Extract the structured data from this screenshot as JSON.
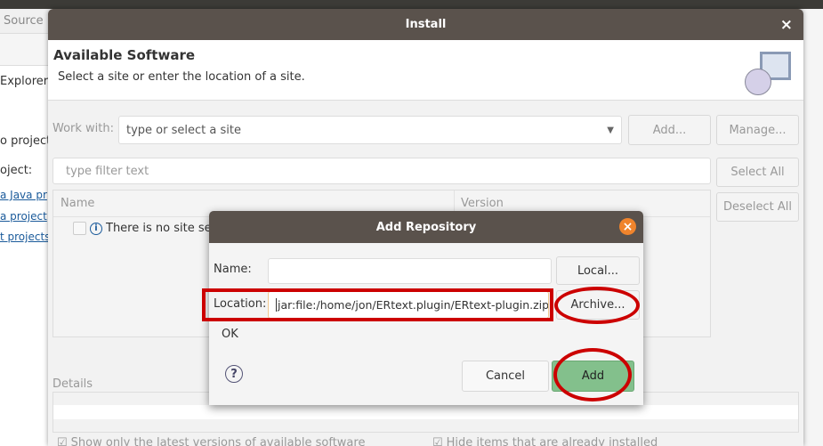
{
  "background_ide": {
    "menu_source": "Source",
    "panel_title": "Explorer",
    "texts": [
      "o project",
      "oject:"
    ],
    "links": [
      "a Java pr",
      "a project",
      "t projects"
    ]
  },
  "install": {
    "title": "Install",
    "close": "×",
    "header_title": "Available Software",
    "header_subtitle": "Select a site or enter the location of a site.",
    "work_with_label": "Work with:",
    "work_with_placeholder": "type or select a site",
    "add_button": "Add...",
    "manage_button": "Manage...",
    "filter_placeholder": "type filter text",
    "select_all": "Select All",
    "deselect_all": "Deselect All",
    "columns": [
      "Name",
      "Version"
    ],
    "rows": [
      {
        "name": "There is no site sele"
      }
    ],
    "details_label": "Details",
    "show_latest": "Show only the latest versions of available software",
    "hide_installed": "Hide items that are already installed"
  },
  "add_repository": {
    "title": "Add Repository",
    "name_label": "Name:",
    "name_value": "",
    "local_button": "Local...",
    "location_label": "Location:",
    "location_value": "jar:file:/home/jon/ERtext.plugin/ERtext-plugin.zip",
    "archive_button": "Archive...",
    "status": "OK",
    "cancel_button": "Cancel",
    "add_button": "Add"
  },
  "colors": {
    "titlebar": "#5a524c",
    "highlight": "#cc0000",
    "add_green": "#83c08c",
    "close_orange": "#f0842c"
  }
}
